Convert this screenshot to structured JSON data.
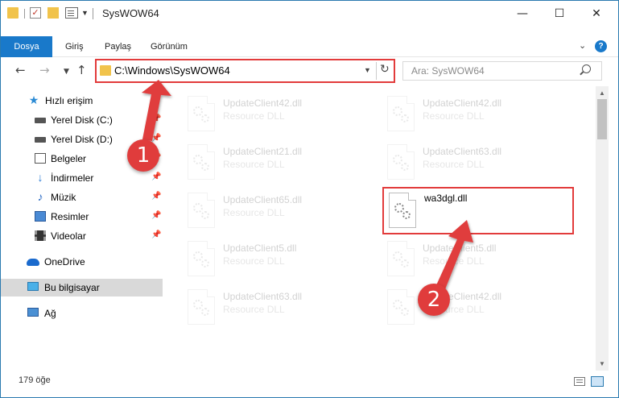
{
  "window": {
    "title": "SysWOW64"
  },
  "ribbon": {
    "file_tab": "Dosya",
    "tabs": [
      "Giriş",
      "Paylaş",
      "Görünüm"
    ]
  },
  "address_bar": {
    "path": "C:\\Windows\\SysWOW64"
  },
  "search": {
    "placeholder": "Ara: SysWOW64"
  },
  "nav_pane": {
    "quick_access": "Hızlı erişim",
    "items": [
      {
        "label": "Yerel Disk (C:)",
        "icon": "drive-icon",
        "pinned": true
      },
      {
        "label": "Yerel Disk (D:)",
        "icon": "drive-icon",
        "pinned": true
      },
      {
        "label": "Belgeler",
        "icon": "documents-icon",
        "pinned": true
      },
      {
        "label": "İndirmeler",
        "icon": "downloads-icon",
        "pinned": true
      },
      {
        "label": "Müzik",
        "icon": "music-icon",
        "pinned": true
      },
      {
        "label": "Resimler",
        "icon": "pictures-icon",
        "pinned": true
      },
      {
        "label": "Videolar",
        "icon": "videos-icon",
        "pinned": true
      }
    ],
    "onedrive": "OneDrive",
    "this_pc": "Bu bilgisayar",
    "network": "Ağ"
  },
  "files": {
    "left": [
      {
        "name": "UpdateClient42.dll",
        "type": "Resource DLL"
      },
      {
        "name": "UpdateClient21.dll",
        "type": "Resource DLL"
      },
      {
        "name": "UpdateClient65.dll",
        "type": "Resource DLL"
      },
      {
        "name": "UpdateClient5.dll",
        "type": "Resource DLL"
      },
      {
        "name": "UpdateClient63.dll",
        "type": "Resource DLL"
      }
    ],
    "right": [
      {
        "name": "UpdateClient42.dll",
        "type": "Resource DLL"
      },
      {
        "name": "UpdateClient63.dll",
        "type": "Resource DLL"
      },
      {
        "name": "wa3dgl.dll",
        "type": ""
      },
      {
        "name": "UpdateClient5.dll",
        "type": "Resource DLL"
      },
      {
        "name": "UpdateClient42.dll",
        "type": "Resource DLL"
      }
    ]
  },
  "status": {
    "count": "179 öğe"
  },
  "annotations": {
    "step1": "1",
    "step2": "2"
  },
  "colors": {
    "accent": "#1979ca",
    "highlight": "#e23b3b"
  }
}
